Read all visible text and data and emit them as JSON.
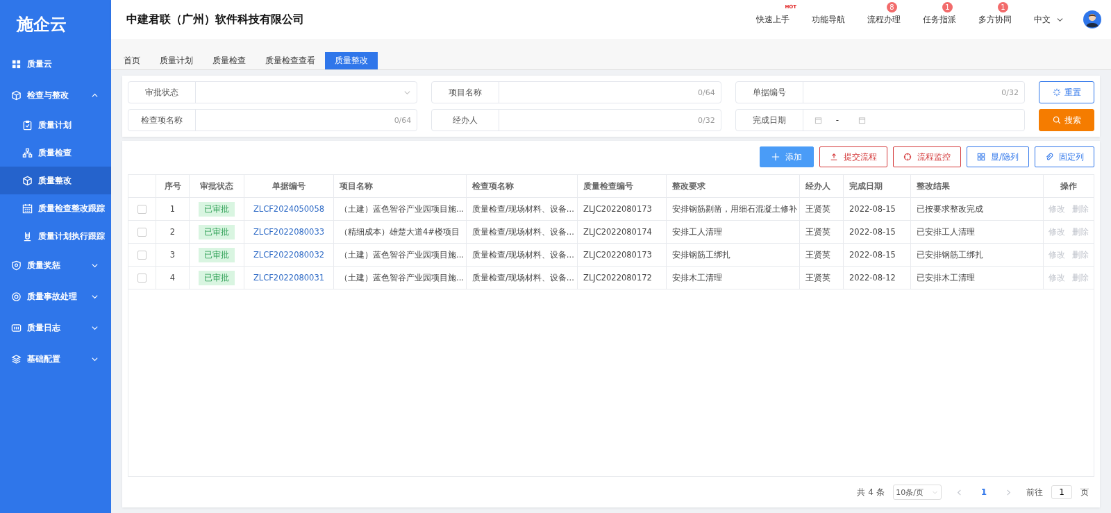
{
  "logo": "施企云",
  "sidebar": {
    "items": [
      {
        "label": "质量云",
        "kind": "link",
        "selected": false
      },
      {
        "label": "检查与整改",
        "kind": "group",
        "expanded": true,
        "selected": false,
        "children": [
          {
            "label": "质量计划",
            "selected": false
          },
          {
            "label": "质量检查",
            "selected": false
          },
          {
            "label": "质量整改",
            "selected": true
          },
          {
            "label": "质量检查整改跟踪",
            "selected": false
          },
          {
            "label": "质量计划执行跟踪",
            "selected": false
          }
        ]
      },
      {
        "label": "质量奖惩",
        "kind": "group",
        "expanded": false,
        "selected": false
      },
      {
        "label": "质量事故处理",
        "kind": "group",
        "expanded": false,
        "selected": false
      },
      {
        "label": "质量日志",
        "kind": "group",
        "expanded": false,
        "selected": false
      },
      {
        "label": "基础配置",
        "kind": "group",
        "expanded": false,
        "selected": false
      }
    ]
  },
  "header": {
    "company": "中建君联（广州）软件科技有限公司",
    "nav": [
      {
        "label": "快速上手",
        "hot": "HOT"
      },
      {
        "label": "功能导航"
      },
      {
        "label": "流程办理",
        "badge": "8"
      },
      {
        "label": "任务指派",
        "badge": "1"
      },
      {
        "label": "多方协同",
        "badge": "1"
      }
    ],
    "language": "中文"
  },
  "tabs": [
    {
      "label": "首页",
      "selected": false
    },
    {
      "label": "质量计划",
      "selected": false
    },
    {
      "label": "质量检查",
      "selected": false
    },
    {
      "label": "质量检查查看",
      "selected": false
    },
    {
      "label": "质量整改",
      "selected": true
    }
  ],
  "filters": [
    {
      "label": "审批状态",
      "kind": "select"
    },
    {
      "label": "项目名称",
      "kind": "text",
      "counter": "0/64"
    },
    {
      "label": "单据编号",
      "kind": "text",
      "counter": "0/32"
    },
    {
      "label": "检查项名称",
      "kind": "text",
      "counter": "0/64"
    },
    {
      "label": "经办人",
      "kind": "text",
      "counter": "0/32"
    },
    {
      "label": "完成日期",
      "kind": "daterange",
      "separator": "-"
    }
  ],
  "filter_buttons": [
    {
      "label": "重置",
      "kind": "reset"
    },
    {
      "label": "搜索",
      "kind": "search"
    }
  ],
  "toolbar": [
    {
      "label": "添加",
      "kind": "primary"
    },
    {
      "label": "提交流程",
      "kind": "danger"
    },
    {
      "label": "流程监控",
      "kind": "danger"
    },
    {
      "label": "显/隐列",
      "kind": "default"
    },
    {
      "label": "固定列",
      "kind": "default"
    }
  ],
  "table": {
    "columns": [
      "序号",
      "审批状态",
      "单据编号",
      "项目名称",
      "检查项名称",
      "质量检查编号",
      "整改要求",
      "经办人",
      "完成日期",
      "整改结果",
      "操作"
    ],
    "rows": [
      {
        "checked": false,
        "no": "1",
        "status": "已审批",
        "doc_no": "ZLCF2024050058",
        "project": "（土建）蓝色智谷产业园项目施...",
        "item": "质量检查/现场材料、设备...",
        "check_no": "ZLJC2022080173",
        "requirement": "安排钢筋剔凿，用细石混凝土修补",
        "handler": "王贤英",
        "date": "2022-08-15",
        "result": "已按要求整改完成",
        "actions": [
          {
            "label": "修改",
            "disabled": true
          },
          {
            "label": "删除",
            "disabled": true
          }
        ]
      },
      {
        "checked": false,
        "no": "2",
        "status": "已审批",
        "doc_no": "ZLCF2022080033",
        "project": "（精细成本）雄楚大道4#楼项目",
        "item": "质量检查/现场材料、设备...",
        "check_no": "ZLJC2022080174",
        "requirement": "安排工人清理",
        "handler": "王贤英",
        "date": "2022-08-15",
        "result": "已安排工人清理",
        "actions": [
          {
            "label": "修改",
            "disabled": true
          },
          {
            "label": "删除",
            "disabled": true
          }
        ]
      },
      {
        "checked": false,
        "no": "3",
        "status": "已审批",
        "doc_no": "ZLCF2022080032",
        "project": "（土建）蓝色智谷产业园项目施...",
        "item": "质量检查/现场材料、设备...",
        "check_no": "ZLJC2022080173",
        "requirement": "安排钢筋工绑扎",
        "handler": "王贤英",
        "date": "2022-08-15",
        "result": "已安排钢筋工绑扎",
        "actions": [
          {
            "label": "修改",
            "disabled": true
          },
          {
            "label": "删除",
            "disabled": true
          }
        ]
      },
      {
        "checked": false,
        "no": "4",
        "status": "已审批",
        "doc_no": "ZLCF2022080031",
        "project": "（土建）蓝色智谷产业园项目施...",
        "item": "质量检查/现场材料、设备...",
        "check_no": "ZLJC2022080172",
        "requirement": "安排木工清理",
        "handler": "王贤英",
        "date": "2022-08-12",
        "result": "已安排木工清理",
        "actions": [
          {
            "label": "修改",
            "disabled": true
          },
          {
            "label": "删除",
            "disabled": true
          }
        ]
      }
    ]
  },
  "pagination": {
    "total": "共 4 条",
    "page_size": "10条/页",
    "pages": [
      {
        "label": "1",
        "selected": true
      }
    ],
    "goto_label": "前往",
    "goto_value": "1",
    "goto_suffix": "页"
  }
}
